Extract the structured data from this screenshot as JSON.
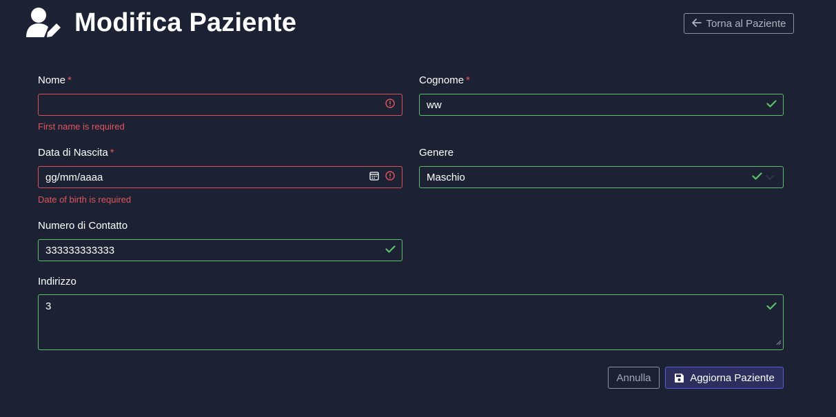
{
  "header": {
    "title": "Modifica Paziente",
    "back_button": "Torna al Paziente"
  },
  "form": {
    "first_name": {
      "label": "Nome",
      "required_mark": "*",
      "value": "",
      "error": "First name is required",
      "status": "invalid"
    },
    "last_name": {
      "label": "Cognome",
      "required_mark": "*",
      "value": "ww",
      "status": "valid"
    },
    "dob": {
      "label": "Data di Nascita",
      "required_mark": "*",
      "placeholder": "gg/mm/aaaa",
      "error": "Date of birth is required",
      "status": "invalid"
    },
    "gender": {
      "label": "Genere",
      "value": "Maschio",
      "status": "valid"
    },
    "phone": {
      "label": "Numero di Contatto",
      "value": "333333333333",
      "status": "valid"
    },
    "address": {
      "label": "Indirizzo",
      "value": "3",
      "status": "valid"
    }
  },
  "actions": {
    "cancel": "Annulla",
    "submit": "Aggiorna Paziente"
  },
  "colors": {
    "background": "#1c2233",
    "valid": "#5cc06a",
    "invalid": "#d9535b",
    "primary_border": "#5b5cdb"
  },
  "icons": {
    "title": "user-edit-icon",
    "back": "arrow-left-icon",
    "error": "exclamation-circle-icon",
    "valid": "check-icon",
    "calendar": "calendar-icon",
    "dropdown": "chevron-down-icon",
    "save": "floppy-disk-icon"
  }
}
